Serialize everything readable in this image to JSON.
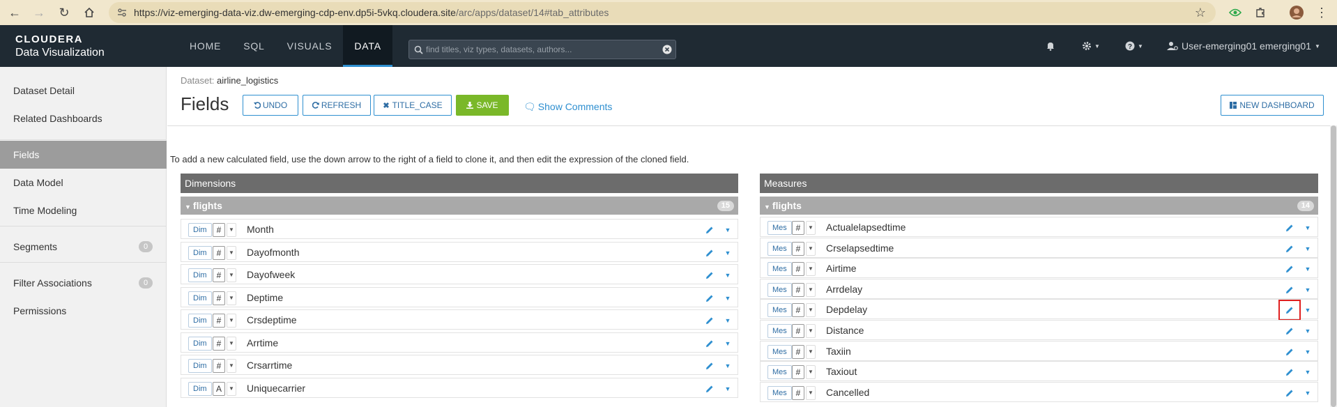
{
  "browser": {
    "url_main": "https://viz-emerging-data-viz.dw-emerging-cdp-env.dp5i-5vkq.cloudera.site",
    "url_path": "/arc/apps/dataset/14#tab_attributes"
  },
  "app": {
    "logo_top": "CLOUDERA",
    "logo_bottom": "Data Visualization",
    "nav": [
      "HOME",
      "SQL",
      "VISUALS",
      "DATA"
    ],
    "search_placeholder": "find titles, viz types, datasets, authors...",
    "user": "User-emerging01 emerging01"
  },
  "sidebar": {
    "items": [
      {
        "label": "Dataset Detail"
      },
      {
        "label": "Related Dashboards"
      },
      {
        "label": "Fields"
      },
      {
        "label": "Data Model"
      },
      {
        "label": "Time Modeling"
      },
      {
        "label": "Segments",
        "badge": "0"
      },
      {
        "label": "Filter Associations",
        "badge": "0"
      },
      {
        "label": "Permissions"
      }
    ]
  },
  "main": {
    "dataset_label": "Dataset:",
    "dataset_name": "airline_logistics",
    "title": "Fields",
    "buttons": {
      "undo": "UNDO",
      "refresh": "REFRESH",
      "title_case": "TITLE_CASE",
      "save": "SAVE",
      "new_dashboard": "NEW DASHBOARD"
    },
    "show_comments": "Show Comments",
    "help_text": "To add a new calculated field, use the down arrow to the right of a field to clone it, and then edit the expression of the cloned field."
  },
  "dimensions": {
    "header": "Dimensions",
    "group": "flights",
    "count": "15",
    "pill": "Dim",
    "rows": [
      {
        "type": "#",
        "name": "Month"
      },
      {
        "type": "#",
        "name": "Dayofmonth"
      },
      {
        "type": "#",
        "name": "Dayofweek"
      },
      {
        "type": "#",
        "name": "Deptime"
      },
      {
        "type": "#",
        "name": "Crsdeptime"
      },
      {
        "type": "#",
        "name": "Arrtime"
      },
      {
        "type": "#",
        "name": "Crsarrtime"
      },
      {
        "type": "A",
        "name": "Uniquecarrier"
      }
    ]
  },
  "measures": {
    "header": "Measures",
    "group": "flights",
    "count": "14",
    "pill": "Mes",
    "rows": [
      {
        "type": "#",
        "name": "Actualelapsedtime"
      },
      {
        "type": "#",
        "name": "Crselapsedtime"
      },
      {
        "type": "#",
        "name": "Airtime"
      },
      {
        "type": "#",
        "name": "Arrdelay"
      },
      {
        "type": "#",
        "name": "Depdelay"
      },
      {
        "type": "#",
        "name": "Distance"
      },
      {
        "type": "#",
        "name": "Taxiin"
      },
      {
        "type": "#",
        "name": "Taxiout"
      },
      {
        "type": "#",
        "name": "Cancelled"
      }
    ]
  },
  "colors": {
    "accent": "#2e8fd0",
    "save": "#7ab829",
    "header_bg": "#1f2a33",
    "highlight": "#e02020"
  }
}
